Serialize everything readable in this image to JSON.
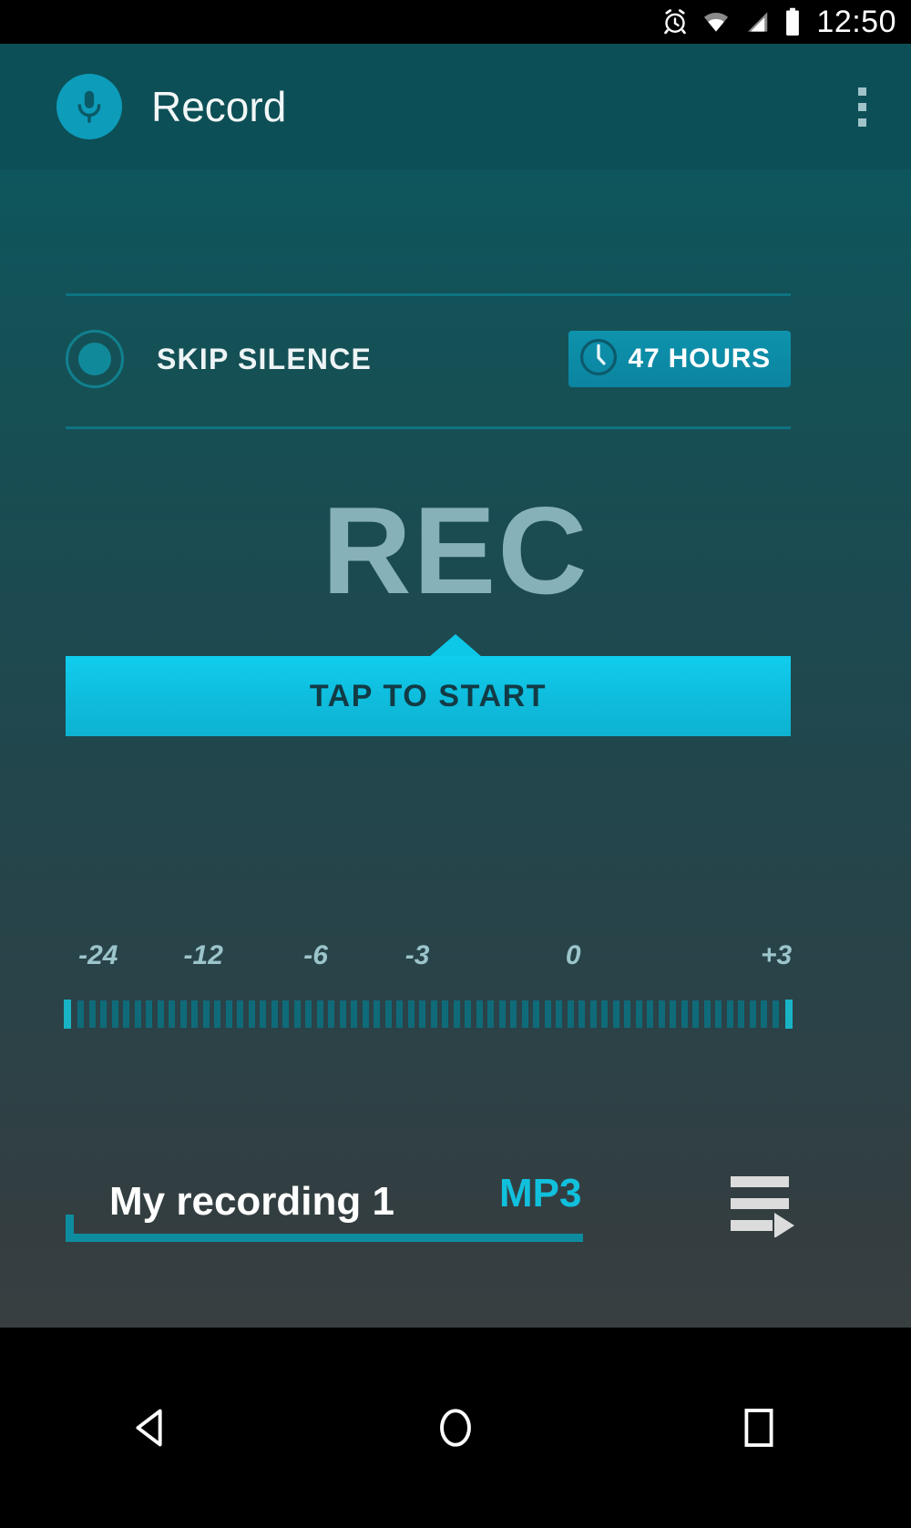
{
  "statusbar": {
    "time": "12:50",
    "icons": [
      "alarm-icon",
      "wifi-icon",
      "signal-icon",
      "battery-icon"
    ]
  },
  "actionbar": {
    "app_icon": "microphone-icon",
    "title": "Record",
    "overflow": "overflow-menu-icon"
  },
  "options": {
    "skip_silence_label": "SKIP SILENCE",
    "skip_silence_state": "off",
    "hours_badge": {
      "icon": "clock-icon",
      "label": "47 HOURS"
    }
  },
  "recorder": {
    "status": "REC",
    "action_label": "TAP TO START"
  },
  "meter": {
    "scale_labels": [
      "-24",
      "-12",
      "-6",
      "-3",
      "0",
      "+3"
    ],
    "scale_positions_pct": [
      4.5,
      19.0,
      34.5,
      48.5,
      70.0,
      98.0
    ],
    "tick_count": 62
  },
  "file": {
    "name": "My recording 1",
    "format": "MP3",
    "list_icon": "playlist-play-icon"
  },
  "navbar": {
    "back": "back-triangle-icon",
    "home": "home-circle-icon",
    "recents": "recents-square-icon"
  },
  "colors": {
    "accent": "#11c0dd",
    "action": "#0fbcdc",
    "badge": "#0b84a0",
    "bg_top": "#0e565d",
    "bg_bottom": "#383f41",
    "rec_text": "#87b1b8"
  }
}
